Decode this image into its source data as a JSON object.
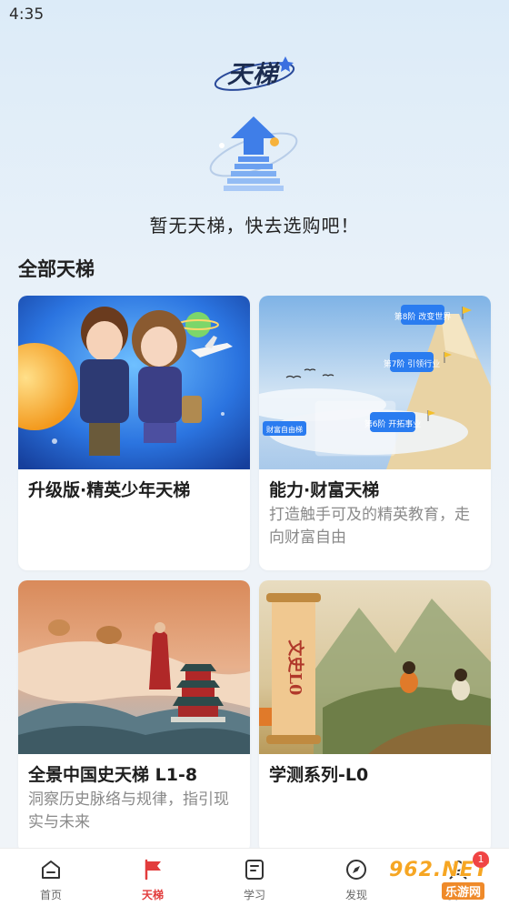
{
  "status_bar": {
    "time": "4:35"
  },
  "header": {
    "logo_text": "天梯"
  },
  "empty_state": {
    "message": "暂无天梯，快去选购吧！"
  },
  "section": {
    "title": "全部天梯"
  },
  "cards": [
    {
      "title": "升级版·精英少年天梯",
      "description": ""
    },
    {
      "title": "能力·财富天梯",
      "description": "打造触手可及的精英教育，走向财富自由",
      "image_labels": {
        "step8": "第8阶 改变世界",
        "step7": "第7阶 引领行业",
        "step6": "第6阶 开拓事业",
        "freedom": "财富自由梯"
      }
    },
    {
      "title": "全景中国史天梯 L1-8",
      "description": "洞察历史脉络与规律，指引现实与未来"
    },
    {
      "title": "学测系列-L0",
      "description": "",
      "image_labels": {
        "scroll": "文史L0"
      }
    }
  ],
  "tabbar": {
    "items": [
      {
        "label": "首页",
        "icon": "home-icon",
        "active": false
      },
      {
        "label": "天梯",
        "icon": "flag-icon",
        "active": true
      },
      {
        "label": "学习",
        "icon": "study-icon",
        "active": false
      },
      {
        "label": "发现",
        "icon": "compass-icon",
        "active": false
      },
      {
        "label": "我的",
        "icon": "profile-icon",
        "active": false
      }
    ],
    "badge_count": "1"
  },
  "watermark": {
    "main": "962.NET",
    "sub": "乐游网"
  },
  "colors": {
    "accent": "#e23c3c",
    "background": "#e8f1f9",
    "card": "#ffffff",
    "muted_text": "#8a8a8a"
  }
}
